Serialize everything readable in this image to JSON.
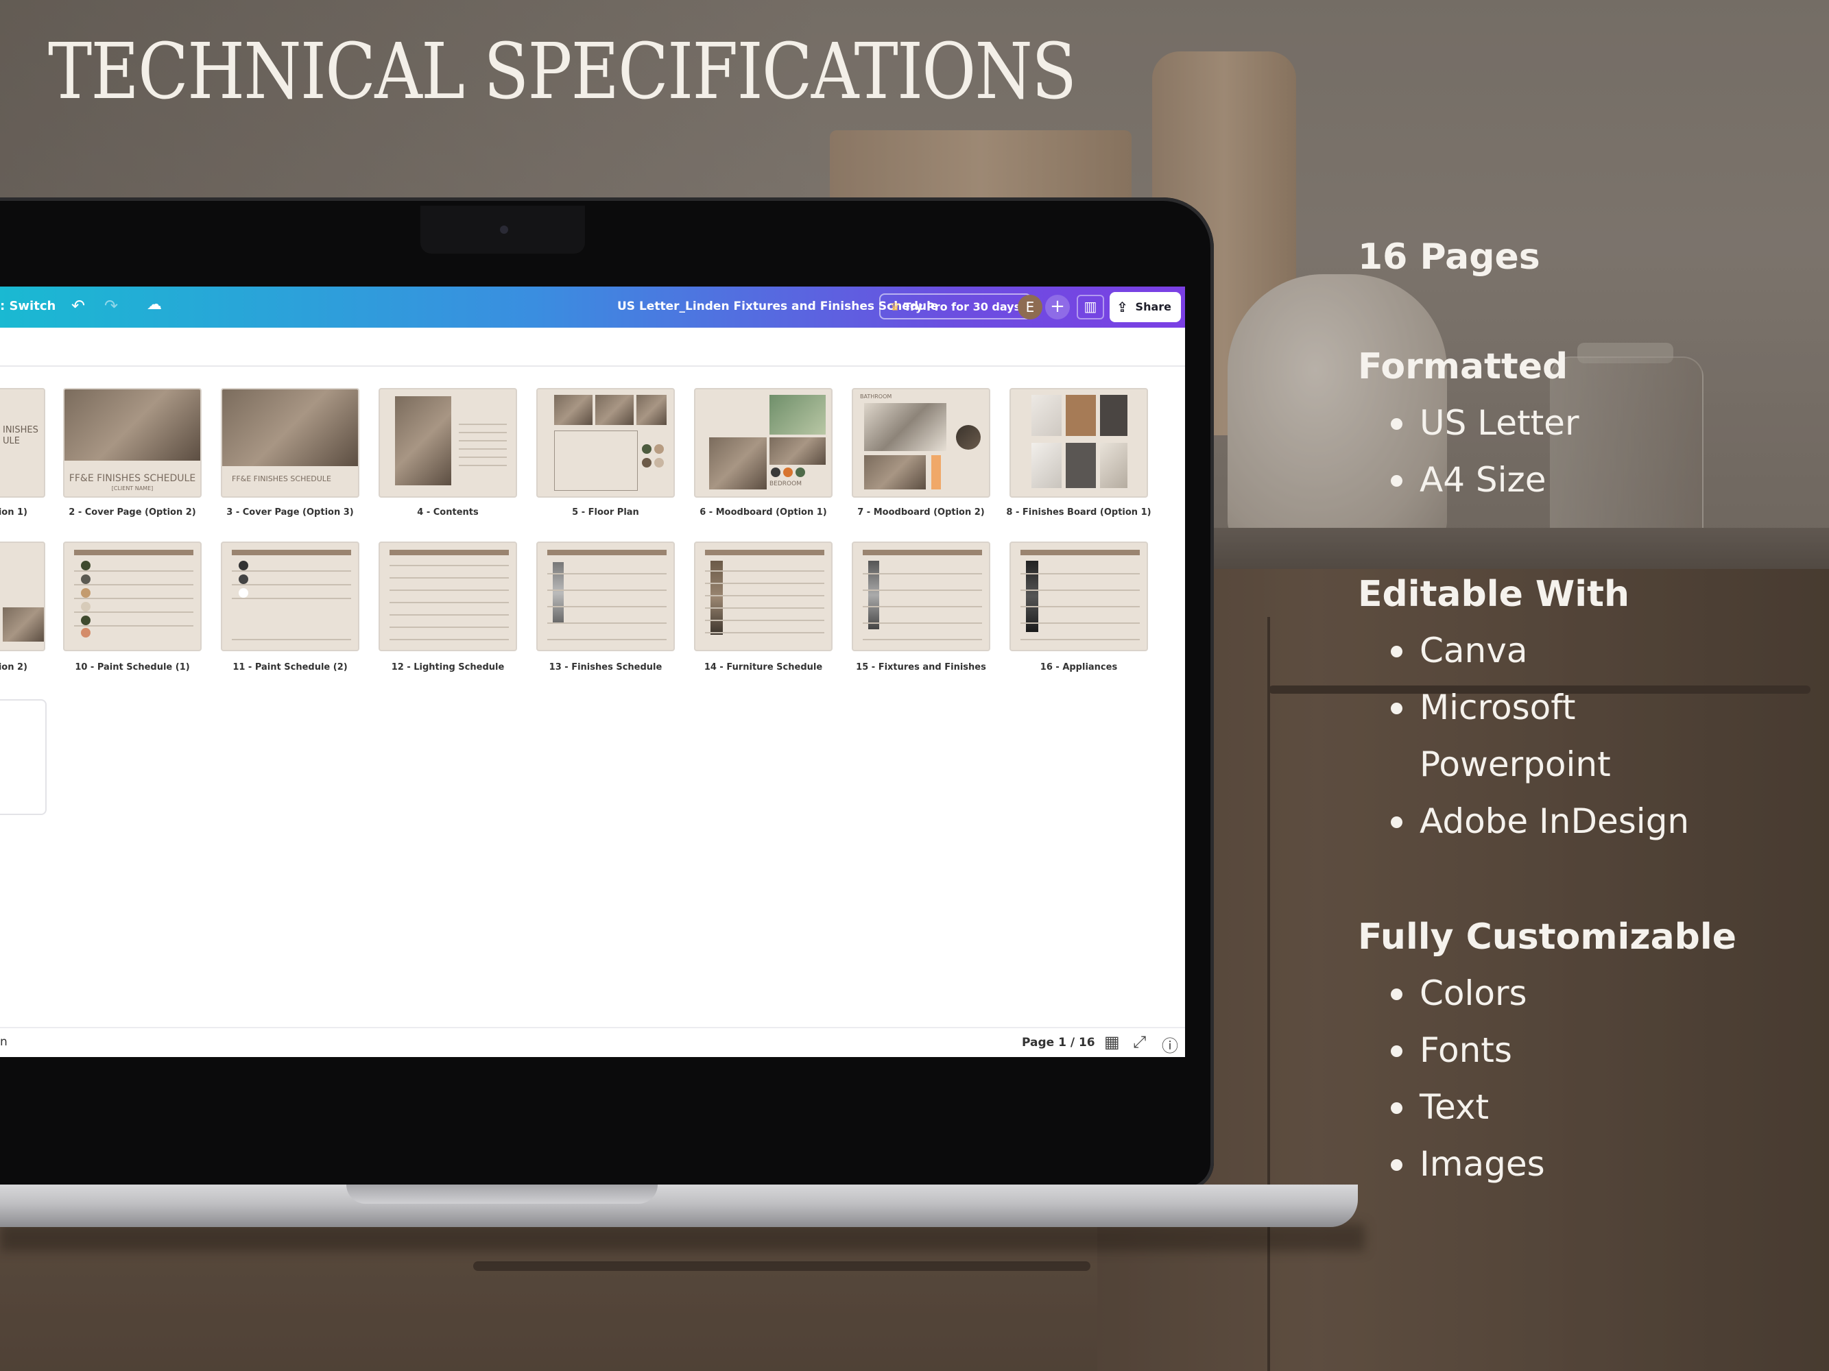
{
  "title": "TECHNICAL SPECIFICATIONS",
  "specs": {
    "pages": "16 Pages",
    "formatted": {
      "heading": "Formatted",
      "items": [
        "US Letter",
        "A4 Size"
      ]
    },
    "editable": {
      "heading": "Editable With",
      "items": [
        "Canva",
        "Microsoft Powerpoint",
        "Adobe InDesign"
      ]
    },
    "customizable": {
      "heading": "Fully Customizable",
      "items": [
        "Colors",
        "Fonts",
        "Text",
        "Images"
      ]
    }
  },
  "editor": {
    "toolbar": {
      "switch_label": ": Switch",
      "doc_title": "US Letter_Linden Fixtures and Finishes Schedule",
      "pro_label": "Try Pro for 30 days",
      "avatar_letter": "E",
      "share_label": "Share"
    },
    "thumbnails_row1": [
      {
        "label": "ption 1)"
      },
      {
        "label": "2 - Cover Page (Option 2)"
      },
      {
        "label": "3 - Cover Page (Option 3)"
      },
      {
        "label": "4 - Contents"
      },
      {
        "label": "5 - Floor Plan"
      },
      {
        "label": "6 - Moodboard (Option 1)"
      },
      {
        "label": "7 - Moodboard (Option 2)"
      },
      {
        "label": "8 - Finishes Board (Option 1)"
      }
    ],
    "thumbnails_row2": [
      {
        "label": "ption 2)"
      },
      {
        "label": "10 - Paint Schedule (1)"
      },
      {
        "label": "11 - Paint Schedule (2)"
      },
      {
        "label": "12 - Lighting Schedule"
      },
      {
        "label": "13 - Finishes Schedule"
      },
      {
        "label": "14 - Furniture Schedule"
      },
      {
        "label": "15 - Fixtures and Finishes"
      },
      {
        "label": "16 - Appliances"
      }
    ],
    "thumb_text": {
      "cover_heading_1": "INISHES",
      "cover_heading_1b": "ULE",
      "cover_heading_2": "FF&E FINISHES SCHEDULE",
      "cover_client": "[CLIENT NAME]",
      "cover_heading_3": "FF&E FINISHES SCHEDULE",
      "moodboard_room": "BEDROOM",
      "moodboard_room_2": "BATHROOM"
    },
    "bottombar": {
      "left_label": "n",
      "page_indicator": "Page 1 / 16"
    }
  },
  "colors": {
    "toolbar_gradient_start": "#1ab9d2",
    "toolbar_gradient_end": "#7b3fe4",
    "thumb_background": "#e9e1d7",
    "text_light": "#f5f2ed"
  },
  "icons": [
    "undo-icon",
    "redo-icon",
    "cloud-save-icon",
    "crown-icon",
    "plus-icon",
    "insights-icon",
    "share-icon",
    "grid-view-icon",
    "fullscreen-icon",
    "help-icon"
  ]
}
